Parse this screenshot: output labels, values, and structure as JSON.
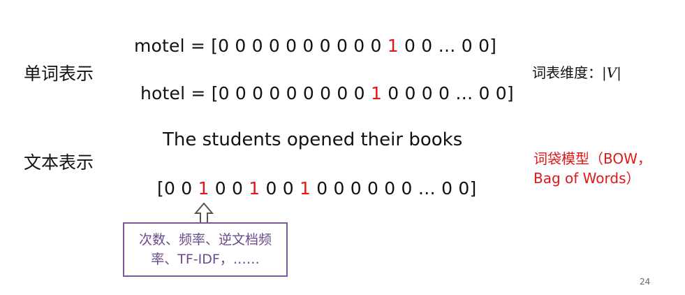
{
  "word_rep": {
    "label": "单词表示",
    "motel": {
      "prefix": "motel = [0 0 0 0 0 0 0 0 0 0 ",
      "hot": "1",
      "suffix": " 0 0 … 0 0]"
    },
    "hotel": {
      "prefix": "hotel = [0 0 0 0 0 0 0 0 0 ",
      "hot": "1",
      "suffix": " 0 0 0 0 … 0 0]"
    },
    "vocab_dim": "词表维度：",
    "vocab_symbol": "|V|"
  },
  "text_rep": {
    "label": "文本表示",
    "sentence": "The students opened their books",
    "vector": {
      "seg1": "[0 0 ",
      "one1": "1",
      "seg2": " 0 0 ",
      "one2": "1",
      "seg3": " 0 0 ",
      "one3": "1",
      "seg4": " 0 0 0 0 0 0 … 0 0]"
    },
    "bow_line1": "词袋模型（BOW，",
    "bow_line2": "Bag of Words）"
  },
  "callout": {
    "line1": "次数、频率、逆文档频",
    "line2": "率、TF-IDF，……"
  },
  "page_number": "24",
  "colors": {
    "highlight": "#e01818",
    "callout_border": "#7b5a9a",
    "callout_text": "#6a4a8c"
  }
}
